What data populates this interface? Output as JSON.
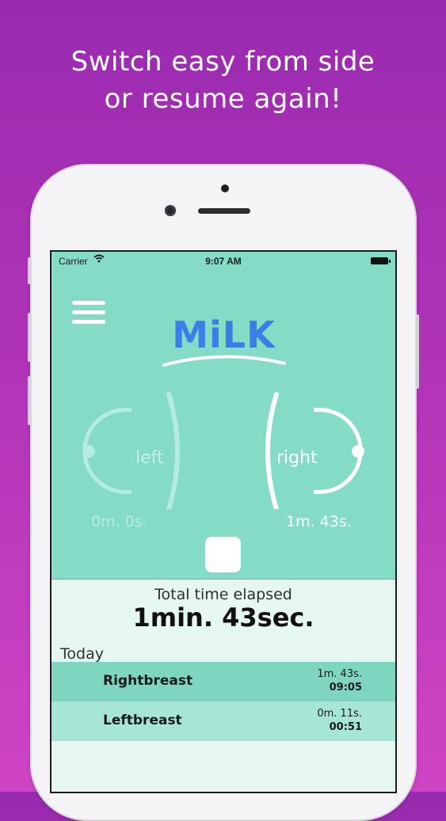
{
  "headline": {
    "line1": "Switch easy from side",
    "line2": "or resume again!"
  },
  "status_bar": {
    "carrier": "Carrier",
    "time": "9:07 AM"
  },
  "app": {
    "logo": "MiLK"
  },
  "left_breast": {
    "label": "left",
    "time": "0m. 0s."
  },
  "right_breast": {
    "label": "right",
    "time": "1m. 43s."
  },
  "summary": {
    "label": "Total time elapsed",
    "value": "1min. 43sec."
  },
  "history": {
    "section_label": "Today",
    "rows": [
      {
        "name": "Rightbreast",
        "duration": "1m. 43s.",
        "clock": "09:05"
      },
      {
        "name": "Leftbreast",
        "duration": "0m. 11s.",
        "clock": "00:51"
      }
    ]
  },
  "colors": {
    "background_top": "#9a2bb0",
    "background_bottom": "#cf45c4",
    "app_teal": "#84dcc6",
    "row_active": "#7ed6c1",
    "row_inactive": "#a6e6d6",
    "logo_blue": "#3a7ee8"
  }
}
